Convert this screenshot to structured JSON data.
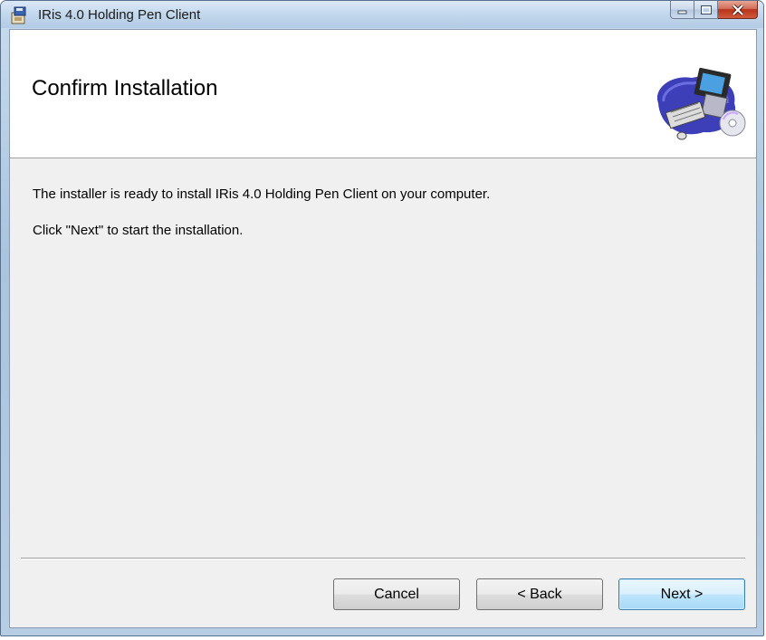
{
  "window": {
    "title": "IRis 4.0 Holding Pen Client",
    "app_icon": "installer-package-icon",
    "controls": {
      "minimize_icon": "minimize-icon",
      "maximize_icon": "maximize-icon",
      "close_icon": "close-icon"
    }
  },
  "banner": {
    "title": "Confirm Installation",
    "image": "computer-setup-icon"
  },
  "content": {
    "line1": "The installer is ready to install IRis 4.0 Holding Pen Client on your computer.",
    "line2": "Click \"Next\" to start the installation."
  },
  "buttons": {
    "cancel": "Cancel",
    "back": "< Back",
    "next": "Next >"
  },
  "colors": {
    "close_button": "#c8442a",
    "default_button_border": "#3c7fb1",
    "client_background": "#f0f0f0"
  }
}
